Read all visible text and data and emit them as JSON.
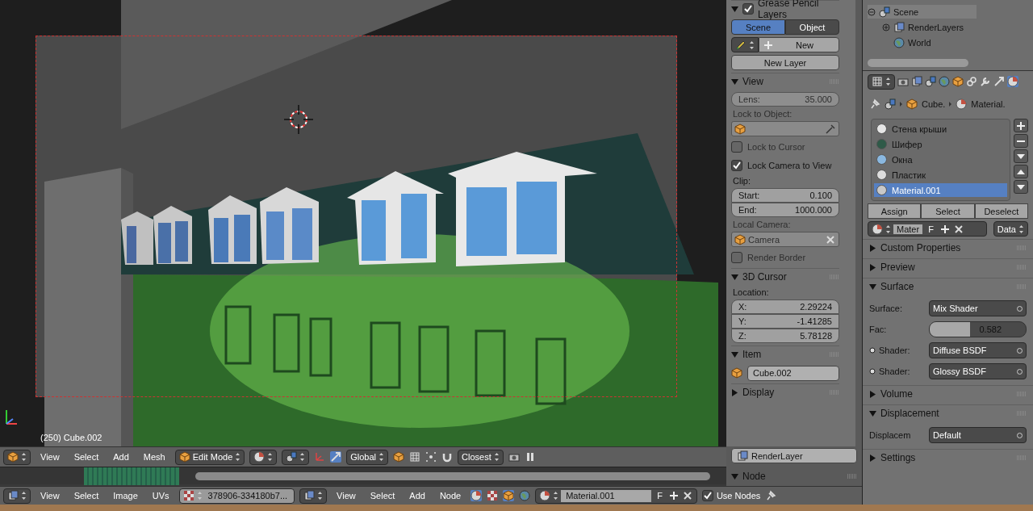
{
  "viewport": {
    "object_label": "(250) Cube.002"
  },
  "view3d_header": {
    "menus": [
      "View",
      "Select",
      "Add",
      "Mesh"
    ],
    "mode": "Edit Mode",
    "orientation": "Global",
    "snap_target": "Closest"
  },
  "n_panel": {
    "grease_pencil": {
      "title": "Grease Pencil Layers",
      "checked": true,
      "tabs": [
        {
          "label": "Scene",
          "selected": true
        },
        {
          "label": "Object",
          "selected": false
        }
      ],
      "new_button": "New",
      "new_layer_button": "New Layer"
    },
    "view": {
      "title": "View",
      "expanded": true,
      "lens": {
        "label": "Lens:",
        "value": "35.000",
        "disabled": true
      },
      "lock_object_label": "Lock to Object:",
      "checkboxes": [
        {
          "label": "Lock to Cursor",
          "checked": false,
          "disabled": true
        },
        {
          "label": "Lock Camera to View",
          "checked": true,
          "disabled": false
        }
      ],
      "clip_label": "Clip:",
      "clip": [
        {
          "label": "Start:",
          "value": "0.100"
        },
        {
          "label": "End:",
          "value": "1000.000"
        }
      ],
      "local_camera_label": "Local Camera:",
      "camera": "Camera",
      "render_border": {
        "label": "Render Border",
        "checked": false,
        "disabled": true
      }
    },
    "cursor": {
      "title": "3D Cursor",
      "expanded": true,
      "location_label": "Location:",
      "coords": [
        {
          "label": "X:",
          "value": "2.29224"
        },
        {
          "label": "Y:",
          "value": "-1.41285"
        },
        {
          "label": "Z:",
          "value": "5.78128"
        }
      ]
    },
    "item": {
      "title": "Item",
      "expanded": true,
      "name": "Cube.002"
    },
    "display": {
      "title": "Display",
      "expanded": false
    }
  },
  "node_panel": {
    "render_layer": "RenderLayer",
    "title": "Node",
    "expanded": true
  },
  "image_editor_header": {
    "menus": [
      "View",
      "Select",
      "Image",
      "UVs"
    ],
    "image": "378906-334180b7..."
  },
  "node_editor_header": {
    "menus": [
      "View",
      "Select",
      "Add",
      "Node"
    ],
    "material": "Material.001",
    "fake_user": "F",
    "use_nodes": {
      "label": "Use Nodes",
      "checked": true
    }
  },
  "outliner": {
    "items": [
      {
        "label": "Scene",
        "expanded": true,
        "children": [
          {
            "label": "RenderLayers",
            "expanded": false
          },
          {
            "label": "World"
          }
        ]
      }
    ]
  },
  "properties": {
    "breadcrumb": [
      "Cube.",
      "Material."
    ],
    "materials": [
      {
        "name": "Стена крыши",
        "color": "#e6e6e6",
        "selected": false
      },
      {
        "name": "Шифер",
        "color": "#2f5a48",
        "selected": false
      },
      {
        "name": "Окна",
        "color": "#8ab8e0",
        "selected": false
      },
      {
        "name": "Пластик",
        "color": "#dcdcdc",
        "selected": false
      },
      {
        "name": "Material.001",
        "color": "#c8c8c8",
        "selected": true
      }
    ],
    "buttons": [
      "Assign",
      "Select",
      "Deselect"
    ],
    "slot_name": "Mater",
    "slot_fake": "F",
    "link": "Data",
    "panels": [
      {
        "title": "Custom Properties",
        "expanded": false
      },
      {
        "title": "Preview",
        "expanded": false
      },
      {
        "title": "Surface",
        "expanded": true,
        "rows": [
          {
            "kind": "menu",
            "label": "Surface:",
            "value": "Mix Shader",
            "socket": false
          },
          {
            "kind": "slider",
            "label": "Fac:",
            "value": "0.582",
            "level": 0.42
          },
          {
            "kind": "menu",
            "label": "Shader:",
            "value": "Diffuse BSDF",
            "socket": true
          },
          {
            "kind": "menu",
            "label": "Shader:",
            "value": "Glossy BSDF",
            "socket": true
          }
        ]
      },
      {
        "title": "Volume",
        "expanded": false
      },
      {
        "title": "Displacement",
        "expanded": true,
        "rows": [
          {
            "kind": "menu",
            "label": "Displacem",
            "value": "Default",
            "socket": false
          }
        ]
      },
      {
        "title": "Settings",
        "expanded": false
      }
    ]
  }
}
